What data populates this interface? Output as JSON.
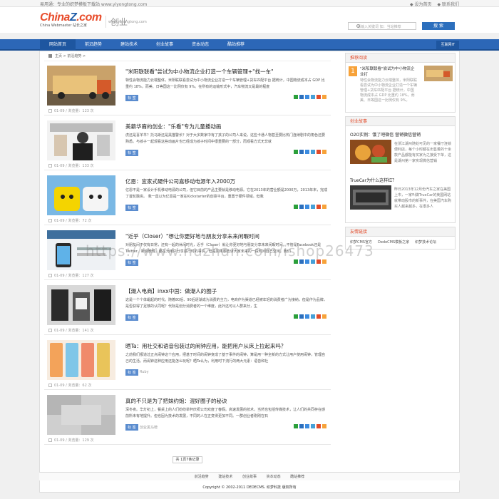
{
  "topbar": {
    "left": "易用通：专业的织梦模板下载站  www.yiyongtong.com",
    "login": "◆ 设为首页",
    "fav": "◆ 联系我们"
  },
  "header": {
    "brand_a": "China",
    "brand_b": "Z",
    "brand_c": ".com",
    "sub": "China Webmaster 站长之家",
    "sub2": "www.yiyongtong.com",
    "channel": "创业",
    "search_placeholder": "请输入关键词 如：当站推荐",
    "search_button": "搜 索"
  },
  "nav": {
    "items": [
      "网站首页",
      "前沿趋势",
      "建站技术",
      "创业故事",
      "资本动态",
      "酷站推荐"
    ],
    "right": "互联网IT"
  },
  "crumb": {
    "home": "主页",
    "sep": ">",
    "section": "前沿趋势",
    ">": ">"
  },
  "articles": [
    {
      "title": "\"米阳联联看\"尝试为中小物流企业打造一个车辆管理+\"找一车\"",
      "desc": "特性会物流能力云端整体，米阳联联看尝试为中小物流企业打造一个车辆管理+货车匹配平台 据统计，中国物流成本占 GDP 比重约 18%，而美、日等国这一比例仅有 9%。在所有的运输形式中，汽车物流又是最的程度",
      "tag": "标 签",
      "date": "01-09 / 浏览量：123 次"
    },
    {
      "title": "美籍华裔的创业：\"乐看\"专为儿童播动画",
      "desc": "虎还是喜羊羊？托马斯还是黑猫警长？对于大多数家中有了孩子的公司人来说，这些卡通人物甚至要比热门连续剧中的角色还要熟悉。与孩子一起观看这些动画片也已经成为孩子时间中很重要的一部分，而观看方式无非就",
      "tag": "标 签",
      "date": "01-09 / 浏览量：133 次"
    },
    {
      "title": "亿恩：宜家式硬件公司嘉移动电源年入2000万",
      "desc": "亿恩不是一家设计手机移动电源的公司，但它目前的产品主要就是移动电源。它在2013年的营业额是2000万，2013年末，完成了首轮融资。 我一直以为亿恩是一家在Kickstarter的创意平台，重置于硬件领域。但我",
      "tag": "标 签",
      "date": "01-09 / 浏览量：72 次"
    },
    {
      "title": "\"近乎（Closer）\"想让你更好地与朋友分享未来闲暇时间",
      "desc": "对朋友间不仅有日常，还有一起的休闲时光，近乎（Closer）就让你更好地与朋友分享未来闲暇时间，不管是Facebook还是Twitter、新浪微博，都在为用户分享进行时的事情，但是如果想告诉大家未来的一段时间自己空闲，我们",
      "tag": "标 签",
      "date": "01-09 / 浏览量：127 次"
    },
    {
      "title": "【潮人电商】inxx中国：做潮人的圈子",
      "desc": "这是一个个体崛起的时代。随着80后、90后逐渐成为消费的主力，电商作为渠道已经被年轻的消费者广为接纳，但是作为品牌，是否获得了足够的认同呢？代际是划分消费者的一个维度，此外还可以人群来分，生",
      "tag": "标 签",
      "date": "01-09 / 浏览量：141 次"
    },
    {
      "title": "晒Ta：用社交和语音包装过的闹钟应用，能把用户从床上拉起来吗？",
      "desc": "之前我们报道过正点闹钟这个应用，把基于时间的闹钟变成了基于事件的闹钟，算是用一种全新的方式让用户使用闹钟，管理自己的生活。而闹钟这种应用还能怎么玩呢？晒Ta认为，利用时下流行的两大元素：语音和社",
      "tag": "标 签",
      "tag2": "Ruby",
      "date": "01-09 / 浏览量：62 次"
    },
    {
      "title": "真的不只是为了把妹约炮：混好圈子的秘诀",
      "desc": "深冬夜。华灯初上，餐桌上的人们纷纷举杯庆祝公司欢度了春假。高速发展的技术，当然也包括传媒技术，让人们的共同存在感前所未有地提升。但也因为技术的发展，不同的人在正变得更加不同。一群创业者刚刚在石",
      "tag": "标 签",
      "tag2": "创业黑马榜",
      "date": "01-09 / 浏览量：129 次"
    }
  ],
  "pager": {
    "text": "共 1页7条记录"
  },
  "side": {
    "rec_title": "推荐阅读",
    "rec_num": "1",
    "rec_item": "\"米阳联联看\"尝试为中小物流企业打",
    "rec_desc": "特性会物流能力云端整体，米阳联联看尝试为中小物流企业打造一个车辆管理+货车匹配平台 据统计，中国物流成本占 GDP 比重约 18%，而美、日等国这一比例仅有 9%。",
    "story_title": "创业故事",
    "story1_t": "O2O实例：饿了吧微信 营销微信营销",
    "story1_d": "在浙江湖州随处可见的一家餐厅连锁便利店，每个小时都在出售着的十余款产品都能有买家为之接受下单，这是湖州第一家实现微信营销",
    "story2_t": "TrueCar为什么这样红？",
    "story2_d": "昨日2013年12月份汽车之家在美国上市，一家叫做TrueCar的美国网站就带动股市的新事件，在美国汽车购买人越来越多，在很多人",
    "links_title": "友情链接",
    "links": [
      "织梦CMS官方",
      "DedeCMS模板之家",
      "织梦技术论坛"
    ]
  },
  "footer": {
    "nav": [
      "前沿趋势",
      "建站技术",
      "创业故事",
      "资本动态",
      "酷站推荐"
    ],
    "copyright": "Copyright © 2002-2011 DEDECMS. 织梦科技 版权所有"
  },
  "watermark": "https://www.huzhan.com/ishop26473",
  "colors": {
    "accent": "#2c67b7",
    "orange": "#e24b2a",
    "tag": "#5a8ccf"
  }
}
